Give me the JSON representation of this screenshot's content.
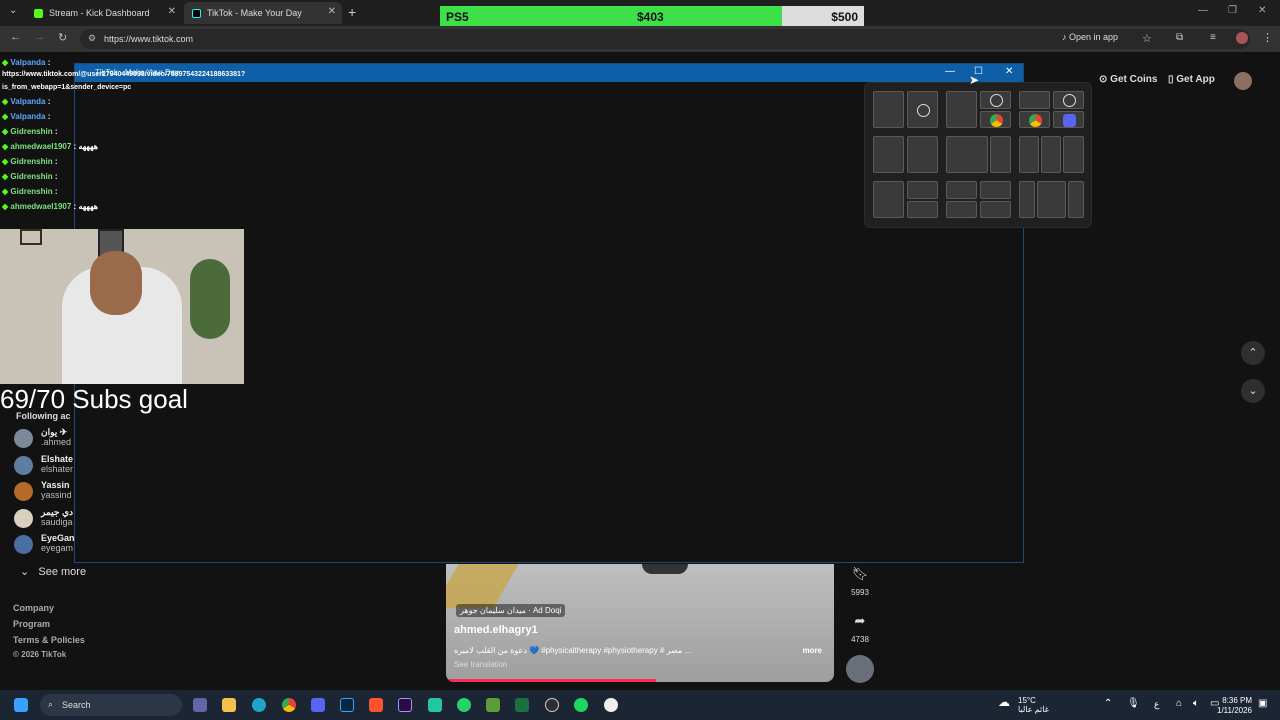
{
  "browser": {
    "tabs": [
      {
        "title": "Stream - Kick Dashboard",
        "active": false,
        "icon": "kick-icon",
        "color": "#53fc18"
      },
      {
        "title": "TikTok - Make Your Day",
        "active": true,
        "icon": "tiktok-icon",
        "color": "#ffffff"
      }
    ],
    "new_tab": "+",
    "url": "https://www.tiktok.com",
    "open_in_app": "Open in app"
  },
  "goal_bar": {
    "label": "PS5",
    "current": "$403",
    "target": "$500",
    "progress": 0.806
  },
  "popup": {
    "title": "TikTok - Make Your Day",
    "url_line1": "https://www.tiktok.com/@user27940449038/video/7589754322418863381?",
    "url_line2": "is_from_webapp=1&sender_device=pc"
  },
  "header_actions": {
    "get_coins": "Get Coins",
    "get_app": "Get App"
  },
  "chat": [
    {
      "user": "Valpanda",
      "color": "blue",
      "msg": ":"
    },
    {
      "user": "Valpanda",
      "color": "blue",
      "msg": ":"
    },
    {
      "user": "Valpanda",
      "color": "blue",
      "msg": ":"
    },
    {
      "user": "Gidrenshin",
      "color": "green",
      "msg": ":"
    },
    {
      "user": "ahmedwael1907",
      "color": "green",
      "msg": ": ههههه"
    },
    {
      "user": "Gidrenshin",
      "color": "green",
      "msg": ":"
    },
    {
      "user": "Gidrenshin",
      "color": "green",
      "msg": ":"
    },
    {
      "user": "Gidrenshin",
      "color": "green",
      "msg": ":"
    },
    {
      "user": "ahmedwael1907",
      "color": "green",
      "msg": ": ههههه"
    }
  ],
  "subs_goal": "69/70 Subs goal",
  "following": {
    "heading": "Following ac",
    "accounts": [
      {
        "name": "يوان ✈",
        "handle": ".ahmed",
        "color": "#7a8a9a"
      },
      {
        "name": "Elshate",
        "handle": "elshater",
        "color": "#5c7fa0"
      },
      {
        "name": "Yassin",
        "handle": "yassind",
        "color": "#b36a2a"
      },
      {
        "name": "دي جيمر",
        "handle": "saudiga",
        "color": "#d9d0c0"
      },
      {
        "name": "EyeGan",
        "handle": "eyegam",
        "color": "#4a6fa0"
      }
    ],
    "see_more": "See more"
  },
  "footer": {
    "company": "Company",
    "program": "Program",
    "terms": "Terms & Policies",
    "copyright": "© 2026 TikTok"
  },
  "video": {
    "tag": "ميدان سليمان جوهر · Ad Doqi",
    "author": "ahmed.elhagry1",
    "description": "دعوة من القلب لاميره 💙 #physicaltherapy #physiotherapy # مصر ...",
    "more": "more",
    "see_translation": "See translation",
    "progress": 0.54
  },
  "side_actions": {
    "saves": "5993",
    "shares": "4738"
  },
  "taskbar": {
    "search": "Search",
    "weather_temp": "15°C",
    "weather_desc": "غائم عالبا",
    "time": "8:36 PM",
    "date": "1/11/2026",
    "lang": "ع"
  }
}
